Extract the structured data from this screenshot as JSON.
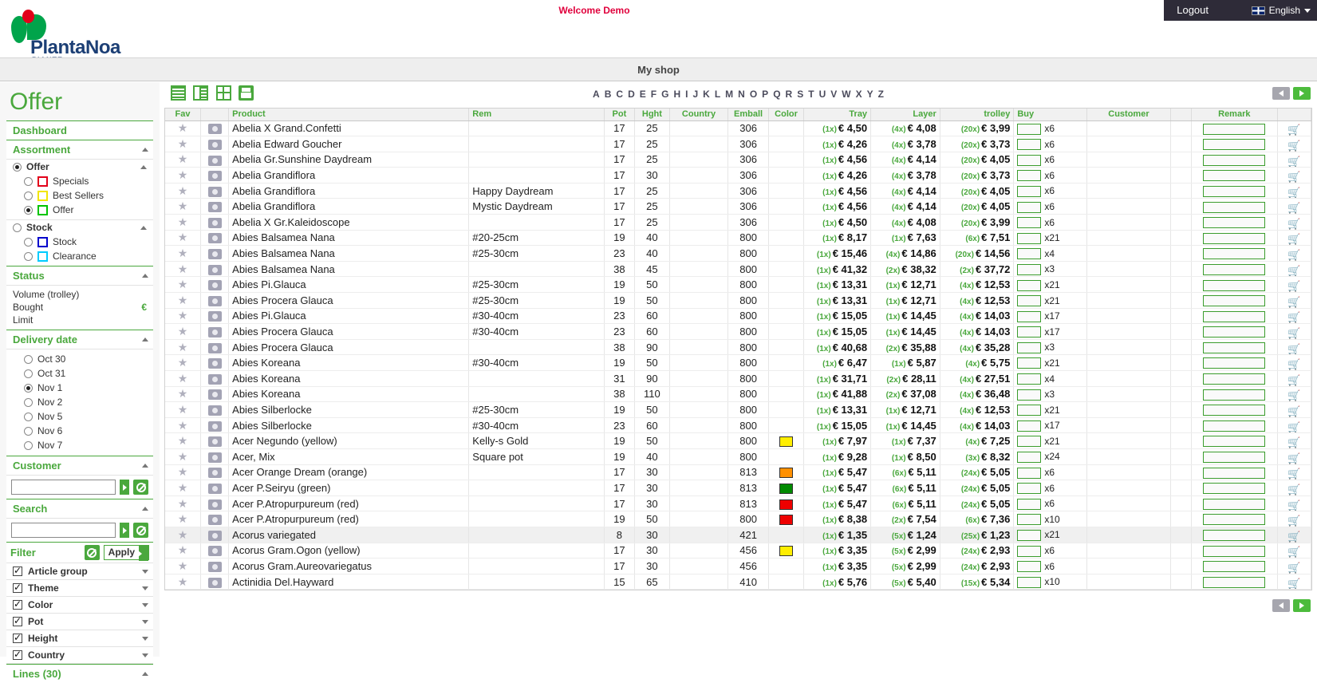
{
  "topbar": {
    "welcome": "Welcome Demo",
    "logout_label": "Logout",
    "language": "English"
  },
  "brand": {
    "name": "PlantaNoa",
    "tagline": "PIANTE & FIORI"
  },
  "shopbar": {
    "title": "My shop"
  },
  "sidebar": {
    "page_title": "Offer",
    "dashboard_label": "Dashboard",
    "assortment": {
      "title": "Assortment",
      "groups": [
        {
          "label": "Offer",
          "selected": true,
          "items": [
            {
              "label": "Specials",
              "color": "#e2001a",
              "selected": false
            },
            {
              "label": "Best Sellers",
              "color": "#f2e600",
              "selected": false
            },
            {
              "label": "Offer",
              "color": "#00c400",
              "selected": true
            }
          ]
        },
        {
          "label": "Stock",
          "selected": false,
          "items": [
            {
              "label": "Stock",
              "color": "#0000cc",
              "selected": false
            },
            {
              "label": "Clearance",
              "color": "#00ccff",
              "selected": false
            }
          ]
        }
      ]
    },
    "status": {
      "title": "Status",
      "rows": [
        {
          "label": "Volume (trolley)",
          "value": ""
        },
        {
          "label": "Bought",
          "value": "€"
        },
        {
          "label": "Limit",
          "value": ""
        }
      ]
    },
    "delivery": {
      "title": "Delivery date",
      "dates": [
        {
          "label": "Oct 30",
          "selected": false
        },
        {
          "label": "Oct 31",
          "selected": false
        },
        {
          "label": "Nov 1",
          "selected": true
        },
        {
          "label": "Nov 2",
          "selected": false
        },
        {
          "label": "Nov 5",
          "selected": false
        },
        {
          "label": "Nov 6",
          "selected": false
        },
        {
          "label": "Nov 7",
          "selected": false
        }
      ]
    },
    "customer": {
      "title": "Customer",
      "value": "",
      "placeholder": ""
    },
    "search": {
      "title": "Search",
      "value": "",
      "placeholder": ""
    },
    "filter": {
      "title": "Filter",
      "apply_label": "Apply",
      "items": [
        {
          "label": "Article group",
          "checked": true
        },
        {
          "label": "Theme",
          "checked": true
        },
        {
          "label": "Color",
          "checked": true
        },
        {
          "label": "Pot",
          "checked": true
        },
        {
          "label": "Height",
          "checked": true
        },
        {
          "label": "Country",
          "checked": true
        }
      ]
    },
    "lines": {
      "title": "Lines (30)"
    }
  },
  "toolbar": {
    "views": [
      "list-view",
      "split-view",
      "grid-view"
    ],
    "print_label": "print",
    "alphabet": [
      "A",
      "B",
      "C",
      "D",
      "E",
      "F",
      "G",
      "H",
      "I",
      "J",
      "K",
      "L",
      "M",
      "N",
      "O",
      "P",
      "Q",
      "R",
      "S",
      "T",
      "U",
      "V",
      "W",
      "X",
      "Y",
      "Z"
    ]
  },
  "table": {
    "columns": [
      "Fav",
      "",
      "Product",
      "Rem",
      "Pot",
      "Hght",
      "Country",
      "Emball",
      "Color",
      "Tray",
      "Layer",
      "trolley",
      "Buy",
      "Customer",
      "",
      "Remark",
      ""
    ],
    "rows": [
      {
        "product": "Abelia X Grand.Confetti",
        "rem": "",
        "pot": "17",
        "hght": "25",
        "country": "",
        "emball": "306",
        "color": "",
        "tray_m": "(1x)",
        "tray": "€ 4,50",
        "layer_m": "(4x)",
        "layer": "€ 4,08",
        "trolley_m": "(20x)",
        "trolley": "€ 3,99",
        "buy": "",
        "x": "x6",
        "customer": "",
        "remark": "",
        "alt": false
      },
      {
        "product": "Abelia Edward Goucher",
        "rem": "",
        "pot": "17",
        "hght": "25",
        "country": "",
        "emball": "306",
        "color": "",
        "tray_m": "(1x)",
        "tray": "€ 4,26",
        "layer_m": "(4x)",
        "layer": "€ 3,78",
        "trolley_m": "(20x)",
        "trolley": "€ 3,73",
        "buy": "",
        "x": "x6",
        "customer": "",
        "remark": "",
        "alt": false
      },
      {
        "product": "Abelia Gr.Sunshine Daydream",
        "rem": "",
        "pot": "17",
        "hght": "25",
        "country": "",
        "emball": "306",
        "color": "",
        "tray_m": "(1x)",
        "tray": "€ 4,56",
        "layer_m": "(4x)",
        "layer": "€ 4,14",
        "trolley_m": "(20x)",
        "trolley": "€ 4,05",
        "buy": "",
        "x": "x6",
        "customer": "",
        "remark": "",
        "alt": false
      },
      {
        "product": "Abelia Grandiflora",
        "rem": "",
        "pot": "17",
        "hght": "30",
        "country": "",
        "emball": "306",
        "color": "",
        "tray_m": "(1x)",
        "tray": "€ 4,26",
        "layer_m": "(4x)",
        "layer": "€ 3,78",
        "trolley_m": "(20x)",
        "trolley": "€ 3,73",
        "buy": "",
        "x": "x6",
        "customer": "",
        "remark": "",
        "alt": false
      },
      {
        "product": "Abelia Grandiflora",
        "rem": "Happy Daydream",
        "pot": "17",
        "hght": "25",
        "country": "",
        "emball": "306",
        "color": "",
        "tray_m": "(1x)",
        "tray": "€ 4,56",
        "layer_m": "(4x)",
        "layer": "€ 4,14",
        "trolley_m": "(20x)",
        "trolley": "€ 4,05",
        "buy": "",
        "x": "x6",
        "customer": "",
        "remark": "",
        "alt": false
      },
      {
        "product": "Abelia Grandiflora",
        "rem": "Mystic Daydream",
        "pot": "17",
        "hght": "25",
        "country": "",
        "emball": "306",
        "color": "",
        "tray_m": "(1x)",
        "tray": "€ 4,56",
        "layer_m": "(4x)",
        "layer": "€ 4,14",
        "trolley_m": "(20x)",
        "trolley": "€ 4,05",
        "buy": "",
        "x": "x6",
        "customer": "",
        "remark": "",
        "alt": false
      },
      {
        "product": "Abelia X Gr.Kaleidoscope",
        "rem": "",
        "pot": "17",
        "hght": "25",
        "country": "",
        "emball": "306",
        "color": "",
        "tray_m": "(1x)",
        "tray": "€ 4,50",
        "layer_m": "(4x)",
        "layer": "€ 4,08",
        "trolley_m": "(20x)",
        "trolley": "€ 3,99",
        "buy": "",
        "x": "x6",
        "customer": "",
        "remark": "",
        "alt": false
      },
      {
        "product": "Abies Balsamea Nana",
        "rem": "#20-25cm",
        "pot": "19",
        "hght": "40",
        "country": "",
        "emball": "800",
        "color": "",
        "tray_m": "(1x)",
        "tray": "€ 8,17",
        "layer_m": "(1x)",
        "layer": "€ 7,63",
        "trolley_m": "(6x)",
        "trolley": "€ 7,51",
        "buy": "",
        "x": "x21",
        "customer": "",
        "remark": "",
        "alt": false
      },
      {
        "product": "Abies Balsamea Nana",
        "rem": "#25-30cm",
        "pot": "23",
        "hght": "40",
        "country": "",
        "emball": "800",
        "color": "",
        "tray_m": "(1x)",
        "tray": "€ 15,46",
        "layer_m": "(4x)",
        "layer": "€ 14,86",
        "trolley_m": "(20x)",
        "trolley": "€ 14,56",
        "buy": "",
        "x": "x4",
        "customer": "",
        "remark": "",
        "alt": false
      },
      {
        "product": "Abies Balsamea Nana",
        "rem": "",
        "pot": "38",
        "hght": "45",
        "country": "",
        "emball": "800",
        "color": "",
        "tray_m": "(1x)",
        "tray": "€ 41,32",
        "layer_m": "(2x)",
        "layer": "€ 38,32",
        "trolley_m": "(2x)",
        "trolley": "€ 37,72",
        "buy": "",
        "x": "x3",
        "customer": "",
        "remark": "",
        "alt": false
      },
      {
        "product": "Abies Pi.Glauca",
        "rem": "#25-30cm",
        "pot": "19",
        "hght": "50",
        "country": "",
        "emball": "800",
        "color": "",
        "tray_m": "(1x)",
        "tray": "€ 13,31",
        "layer_m": "(1x)",
        "layer": "€ 12,71",
        "trolley_m": "(4x)",
        "trolley": "€ 12,53",
        "buy": "",
        "x": "x21",
        "customer": "",
        "remark": "",
        "alt": false
      },
      {
        "product": "Abies Procera Glauca",
        "rem": "#25-30cm",
        "pot": "19",
        "hght": "50",
        "country": "",
        "emball": "800",
        "color": "",
        "tray_m": "(1x)",
        "tray": "€ 13,31",
        "layer_m": "(1x)",
        "layer": "€ 12,71",
        "trolley_m": "(4x)",
        "trolley": "€ 12,53",
        "buy": "",
        "x": "x21",
        "customer": "",
        "remark": "",
        "alt": false
      },
      {
        "product": "Abies Pi.Glauca",
        "rem": "#30-40cm",
        "pot": "23",
        "hght": "60",
        "country": "",
        "emball": "800",
        "color": "",
        "tray_m": "(1x)",
        "tray": "€ 15,05",
        "layer_m": "(1x)",
        "layer": "€ 14,45",
        "trolley_m": "(4x)",
        "trolley": "€ 14,03",
        "buy": "",
        "x": "x17",
        "customer": "",
        "remark": "",
        "alt": false
      },
      {
        "product": "Abies Procera Glauca",
        "rem": "#30-40cm",
        "pot": "23",
        "hght": "60",
        "country": "",
        "emball": "800",
        "color": "",
        "tray_m": "(1x)",
        "tray": "€ 15,05",
        "layer_m": "(1x)",
        "layer": "€ 14,45",
        "trolley_m": "(4x)",
        "trolley": "€ 14,03",
        "buy": "",
        "x": "x17",
        "customer": "",
        "remark": "",
        "alt": false
      },
      {
        "product": "Abies Procera Glauca",
        "rem": "",
        "pot": "38",
        "hght": "90",
        "country": "",
        "emball": "800",
        "color": "",
        "tray_m": "(1x)",
        "tray": "€ 40,68",
        "layer_m": "(2x)",
        "layer": "€ 35,88",
        "trolley_m": "(4x)",
        "trolley": "€ 35,28",
        "buy": "",
        "x": "x3",
        "customer": "",
        "remark": "",
        "alt": false
      },
      {
        "product": "Abies Koreana",
        "rem": "#30-40cm",
        "pot": "19",
        "hght": "50",
        "country": "",
        "emball": "800",
        "color": "",
        "tray_m": "(1x)",
        "tray": "€ 6,47",
        "layer_m": "(1x)",
        "layer": "€ 5,87",
        "trolley_m": "(4x)",
        "trolley": "€ 5,75",
        "buy": "",
        "x": "x21",
        "customer": "",
        "remark": "",
        "alt": false
      },
      {
        "product": "Abies Koreana",
        "rem": "",
        "pot": "31",
        "hght": "90",
        "country": "",
        "emball": "800",
        "color": "",
        "tray_m": "(1x)",
        "tray": "€ 31,71",
        "layer_m": "(2x)",
        "layer": "€ 28,11",
        "trolley_m": "(4x)",
        "trolley": "€ 27,51",
        "buy": "",
        "x": "x4",
        "customer": "",
        "remark": "",
        "alt": false
      },
      {
        "product": "Abies Koreana",
        "rem": "",
        "pot": "38",
        "hght": "110",
        "country": "",
        "emball": "800",
        "color": "",
        "tray_m": "(1x)",
        "tray": "€ 41,88",
        "layer_m": "(2x)",
        "layer": "€ 37,08",
        "trolley_m": "(4x)",
        "trolley": "€ 36,48",
        "buy": "",
        "x": "x3",
        "customer": "",
        "remark": "",
        "alt": false
      },
      {
        "product": "Abies Silberlocke",
        "rem": "#25-30cm",
        "pot": "19",
        "hght": "50",
        "country": "",
        "emball": "800",
        "color": "",
        "tray_m": "(1x)",
        "tray": "€ 13,31",
        "layer_m": "(1x)",
        "layer": "€ 12,71",
        "trolley_m": "(4x)",
        "trolley": "€ 12,53",
        "buy": "",
        "x": "x21",
        "customer": "",
        "remark": "",
        "alt": false
      },
      {
        "product": "Abies Silberlocke",
        "rem": "#30-40cm",
        "pot": "23",
        "hght": "60",
        "country": "",
        "emball": "800",
        "color": "",
        "tray_m": "(1x)",
        "tray": "€ 15,05",
        "layer_m": "(1x)",
        "layer": "€ 14,45",
        "trolley_m": "(4x)",
        "trolley": "€ 14,03",
        "buy": "",
        "x": "x17",
        "customer": "",
        "remark": "",
        "alt": false
      },
      {
        "product": "Acer Negundo (yellow)",
        "rem": "Kelly-s Gold",
        "pot": "19",
        "hght": "50",
        "country": "",
        "emball": "800",
        "color": "#ffee00",
        "tray_m": "(1x)",
        "tray": "€ 7,97",
        "layer_m": "(1x)",
        "layer": "€ 7,37",
        "trolley_m": "(4x)",
        "trolley": "€ 7,25",
        "buy": "",
        "x": "x21",
        "customer": "",
        "remark": "",
        "alt": false
      },
      {
        "product": "Acer, Mix",
        "rem": "Square pot",
        "pot": "19",
        "hght": "40",
        "country": "",
        "emball": "800",
        "color": "",
        "tray_m": "(1x)",
        "tray": "€ 9,28",
        "layer_m": "(1x)",
        "layer": "€ 8,50",
        "trolley_m": "(3x)",
        "trolley": "€ 8,32",
        "buy": "",
        "x": "x24",
        "customer": "",
        "remark": "",
        "alt": false
      },
      {
        "product": "Acer Orange Dream (orange)",
        "rem": "",
        "pot": "17",
        "hght": "30",
        "country": "",
        "emball": "813",
        "color": "#ff9000",
        "tray_m": "(1x)",
        "tray": "€ 5,47",
        "layer_m": "(6x)",
        "layer": "€ 5,11",
        "trolley_m": "(24x)",
        "trolley": "€ 5,05",
        "buy": "",
        "x": "x6",
        "customer": "",
        "remark": "",
        "alt": false
      },
      {
        "product": "Acer P.Seiryu (green)",
        "rem": "",
        "pot": "17",
        "hght": "30",
        "country": "",
        "emball": "813",
        "color": "#008a00",
        "tray_m": "(1x)",
        "tray": "€ 5,47",
        "layer_m": "(6x)",
        "layer": "€ 5,11",
        "trolley_m": "(24x)",
        "trolley": "€ 5,05",
        "buy": "",
        "x": "x6",
        "customer": "",
        "remark": "",
        "alt": false
      },
      {
        "product": "Acer P.Atropurpureum (red)",
        "rem": "",
        "pot": "17",
        "hght": "30",
        "country": "",
        "emball": "813",
        "color": "#ee0000",
        "tray_m": "(1x)",
        "tray": "€ 5,47",
        "layer_m": "(6x)",
        "layer": "€ 5,11",
        "trolley_m": "(24x)",
        "trolley": "€ 5,05",
        "buy": "",
        "x": "x6",
        "customer": "",
        "remark": "",
        "alt": false
      },
      {
        "product": "Acer P.Atropurpureum (red)",
        "rem": "",
        "pot": "19",
        "hght": "50",
        "country": "",
        "emball": "800",
        "color": "#ee0000",
        "tray_m": "(1x)",
        "tray": "€ 8,38",
        "layer_m": "(2x)",
        "layer": "€ 7,54",
        "trolley_m": "(6x)",
        "trolley": "€ 7,36",
        "buy": "",
        "x": "x10",
        "customer": "",
        "remark": "",
        "alt": false
      },
      {
        "product": "Acorus variegated",
        "rem": "",
        "pot": "8",
        "hght": "30",
        "country": "",
        "emball": "421",
        "color": "",
        "tray_m": "(1x)",
        "tray": "€ 1,35",
        "layer_m": "(5x)",
        "layer": "€ 1,24",
        "trolley_m": "(25x)",
        "trolley": "€ 1,23",
        "buy": "",
        "x": "x21",
        "customer": "",
        "remark": "",
        "alt": true
      },
      {
        "product": "Acorus Gram.Ogon (yellow)",
        "rem": "",
        "pot": "17",
        "hght": "30",
        "country": "",
        "emball": "456",
        "color": "#ffee00",
        "tray_m": "(1x)",
        "tray": "€ 3,35",
        "layer_m": "(5x)",
        "layer": "€ 2,99",
        "trolley_m": "(24x)",
        "trolley": "€ 2,93",
        "buy": "",
        "x": "x6",
        "customer": "",
        "remark": "",
        "alt": false
      },
      {
        "product": "Acorus Gram.Aureovariegatus",
        "rem": "",
        "pot": "17",
        "hght": "30",
        "country": "",
        "emball": "456",
        "color": "",
        "tray_m": "(1x)",
        "tray": "€ 3,35",
        "layer_m": "(5x)",
        "layer": "€ 2,99",
        "trolley_m": "(24x)",
        "trolley": "€ 2,93",
        "buy": "",
        "x": "x6",
        "customer": "",
        "remark": "",
        "alt": false
      },
      {
        "product": "Actinidia Del.Hayward",
        "rem": "",
        "pot": "15",
        "hght": "65",
        "country": "",
        "emball": "410",
        "color": "",
        "tray_m": "(1x)",
        "tray": "€ 5,76",
        "layer_m": "(5x)",
        "layer": "€ 5,40",
        "trolley_m": "(15x)",
        "trolley": "€ 5,34",
        "buy": "",
        "x": "x10",
        "customer": "",
        "remark": "",
        "alt": false
      }
    ]
  }
}
